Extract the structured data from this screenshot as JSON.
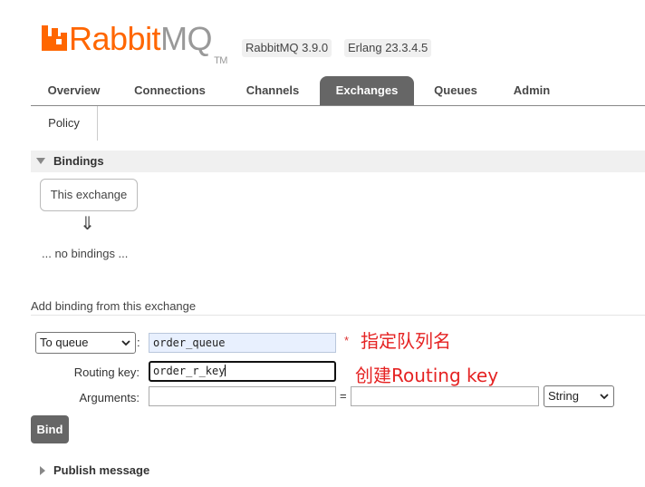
{
  "header": {
    "logo_rabbit": "Rabbit",
    "logo_mq": "MQ",
    "logo_tm": "TM",
    "rabbitmq_version": "RabbitMQ 3.9.0",
    "erlang_version": "Erlang 23.3.4.5",
    "brand_color": "#ff6600"
  },
  "nav": {
    "tabs": [
      {
        "label": "Overview"
      },
      {
        "label": "Connections"
      },
      {
        "label": "Channels"
      },
      {
        "label": "Exchanges",
        "active": true
      },
      {
        "label": "Queues"
      },
      {
        "label": "Admin"
      }
    ],
    "subtab": "Policy"
  },
  "bindings": {
    "section_title": "Bindings",
    "source_box": "This exchange",
    "arrow": "⇓",
    "empty_text": "... no bindings ..."
  },
  "add_binding": {
    "title": "Add binding from this exchange",
    "destination_type": "To queue",
    "colon": ":",
    "destination_value": "order_queue",
    "required_mark": "*",
    "routing_key_label": "Routing key:",
    "routing_key_value": "order_r_key",
    "arguments_label": "Arguments:",
    "arg_key_value": "",
    "equals": "=",
    "arg_value_value": "",
    "arg_type": "String",
    "bind_button": "Bind"
  },
  "annotations": {
    "queue_note": "指定队列名",
    "routing_key_note": "创建Routing key",
    "color": "#e52323"
  },
  "publish": {
    "title": "Publish message"
  }
}
